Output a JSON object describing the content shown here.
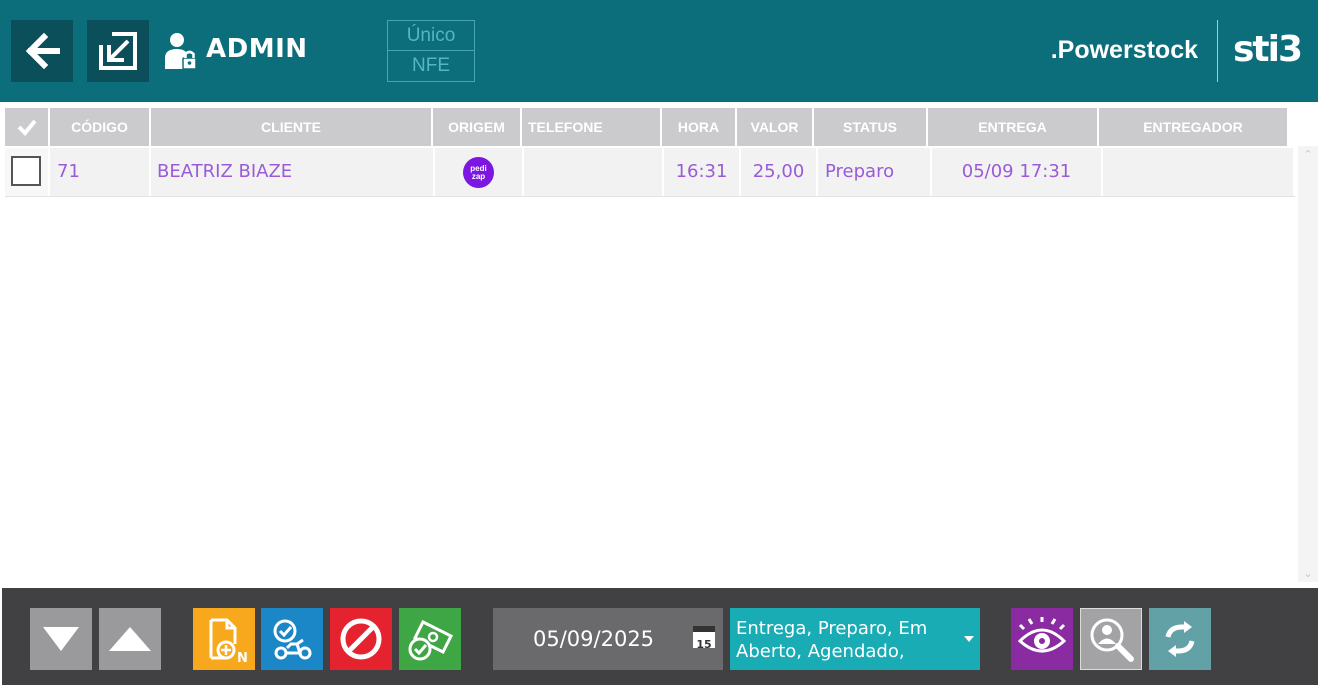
{
  "header": {
    "user_name": "ADMIN",
    "mode_options": [
      "Único",
      "NFE"
    ],
    "brand": ".Powerstock",
    "logo_text": "sti3"
  },
  "table": {
    "columns": [
      "CÓDIGO",
      "CLIENTE",
      "ORIGEM",
      "TELEFONE",
      "HORA",
      "VALOR",
      "STATUS",
      "ENTREGA",
      "ENTREGADOR"
    ],
    "rows": [
      {
        "codigo": "71",
        "cliente": "BEATRIZ BIAZE",
        "origem": "pedi zap",
        "telefone": "",
        "hora": "16:31",
        "valor": "25,00",
        "status": "Preparo",
        "entrega": "05/09 17:31",
        "entregador": ""
      }
    ]
  },
  "footer": {
    "date": "05/09/2025",
    "calendar_day": "15",
    "status_filter": "Entrega, Preparo, Em Aberto, Agendado,"
  },
  "colors": {
    "header_bg": "#0d6e7b",
    "row_text": "#9a5bd6",
    "footer_bg": "#414143",
    "btn_yellow": "#f7a81c",
    "btn_blue": "#1b87c7",
    "btn_red": "#e5232e",
    "btn_green": "#3ea645",
    "btn_purple": "#8a2ba2",
    "btn_teal": "#62a1a5",
    "filter_bg": "#1aacb5"
  }
}
